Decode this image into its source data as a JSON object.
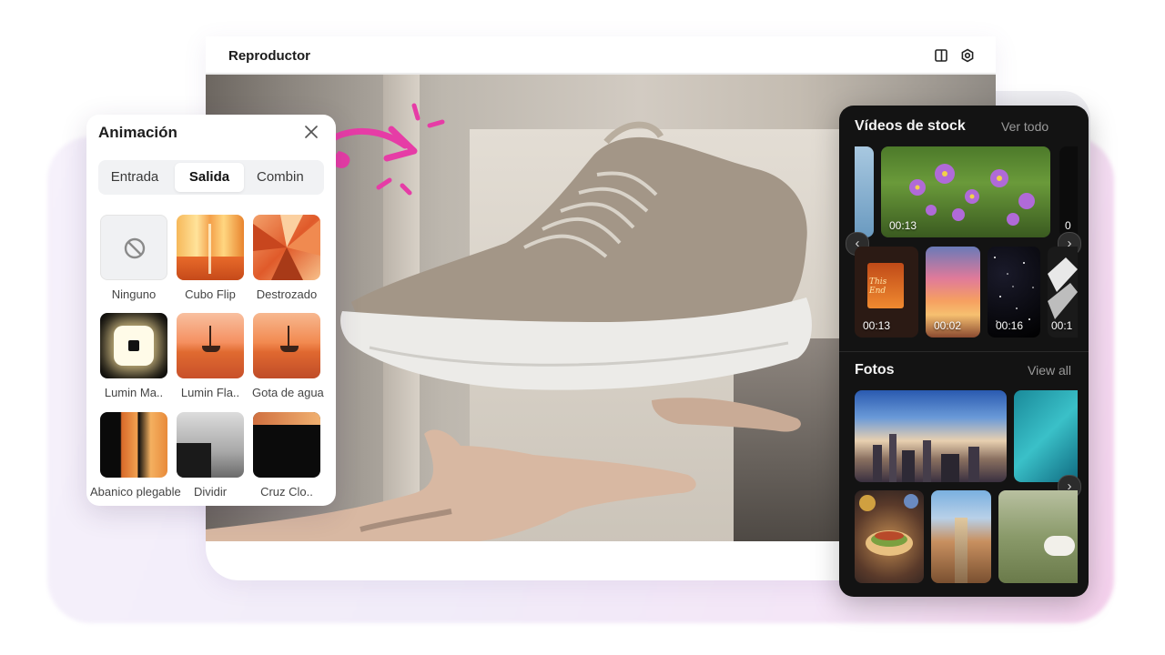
{
  "player": {
    "title": "Reproductor"
  },
  "animation": {
    "title": "Animación",
    "tabs": [
      {
        "label": "Entrada"
      },
      {
        "label": "Salida"
      },
      {
        "label": "Combin"
      }
    ],
    "active_tab": "Salida",
    "effects": [
      {
        "label": "Ninguno"
      },
      {
        "label": "Cubo Flip"
      },
      {
        "label": "Destrozado"
      },
      {
        "label": "Lumin Ma.."
      },
      {
        "label": "Lumin Fla.."
      },
      {
        "label": "Gota de agua"
      },
      {
        "label": "Abanico plegable"
      },
      {
        "label": "Dividir"
      },
      {
        "label": "Cruz Clo.."
      }
    ]
  },
  "stock": {
    "videos_title": "Vídeos de stock",
    "videos_link": "Ver todo",
    "videos": [
      {
        "duration": "00:13"
      },
      {
        "duration": "00:13"
      },
      {
        "duration": "00:02"
      },
      {
        "duration": "00:16"
      },
      {
        "duration": "00:1"
      },
      {
        "duration": "0"
      }
    ],
    "photos_title": "Fotos",
    "photos_link": "View all",
    "thumb_text": "This End"
  },
  "colors": {
    "accent_pink": "#e63ca6",
    "panel_dark": "#131313"
  }
}
